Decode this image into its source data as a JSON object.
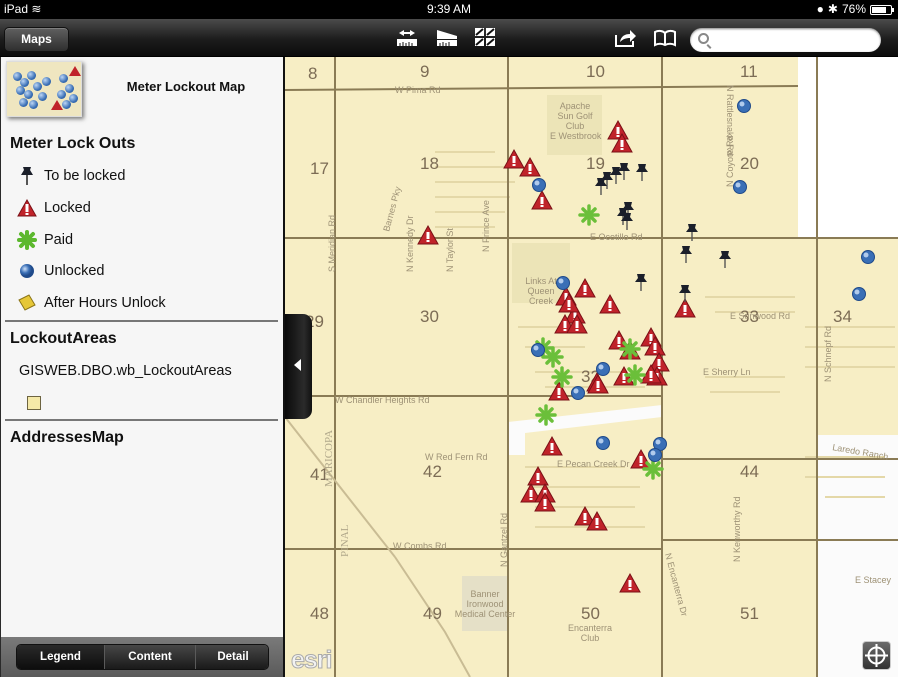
{
  "status_bar": {
    "device": "iPad",
    "time": "9:39 AM",
    "battery": "76%",
    "battery_level": 0.76
  },
  "toolbar": {
    "maps_button": "Maps",
    "icons": [
      "measure-icon",
      "basemap-icon",
      "gallery-icon",
      "share-icon",
      "bookmarks-icon"
    ],
    "search_placeholder": ""
  },
  "sidebar": {
    "map_title": "Meter Lockout Map",
    "sections": [
      {
        "title": "Meter Lock Outs",
        "items": [
          {
            "label": "To be locked",
            "icon": "pushpin-icon"
          },
          {
            "label": "Locked",
            "icon": "warning-triangle-icon"
          },
          {
            "label": "Paid",
            "icon": "green-star-icon"
          },
          {
            "label": "Unlocked",
            "icon": "blue-globe-icon"
          },
          {
            "label": "After Hours Unlock",
            "icon": "sticky-note-icon"
          }
        ]
      },
      {
        "title": "LockoutAreas",
        "layer": "GISWEB.DBO.wb_LockoutAreas",
        "swatch_color": "#f5e9a8"
      },
      {
        "title": "AddressesMap"
      }
    ],
    "tabs": [
      {
        "label": "Legend",
        "active": true
      },
      {
        "label": "Content",
        "active": false
      },
      {
        "label": "Detail",
        "active": false
      }
    ]
  },
  "map": {
    "sections": [
      "8",
      "9",
      "10",
      "11",
      "17",
      "18",
      "19",
      "20",
      "29",
      "30",
      "32",
      "33",
      "34",
      "41",
      "42",
      "44",
      "48",
      "49",
      "50",
      "51"
    ],
    "streets": [
      "W Pima Rd",
      "E Westbrook",
      "N Rattlesnake Rd",
      "N Coyote Rd",
      "E Ocotillo Rd",
      "Barnes Pky",
      "N Kennedy Dr",
      "N Taylor St",
      "N Prince Ave",
      "S Meridian Rd",
      "W Chandler Heights Rd",
      "E Sunwood Rd",
      "E Sherry Ln",
      "N Schnepf Rd",
      "E Pecan Creek Dr",
      "W Red Fern Rd",
      "W Combs Rd",
      "N Gantzel Rd",
      "N Encanterra Dr",
      "N Kenworthy Rd",
      "Laredo Ranch",
      "E Stacey"
    ],
    "places": [
      "Apache Sun Golf Club",
      "Links At Queen Creek",
      "Banner Ironwood Medical Center",
      "Encanterra Club"
    ],
    "county_labels": [
      "MARICOPA",
      "PINAL"
    ],
    "attribution": "esri",
    "colors": {
      "area_fill": "#f7eec5",
      "locked": "#c0232a",
      "paid": "#6bbf3a",
      "unlocked": "#3a6fb6",
      "to_be_locked": "#1b1f2a"
    }
  }
}
